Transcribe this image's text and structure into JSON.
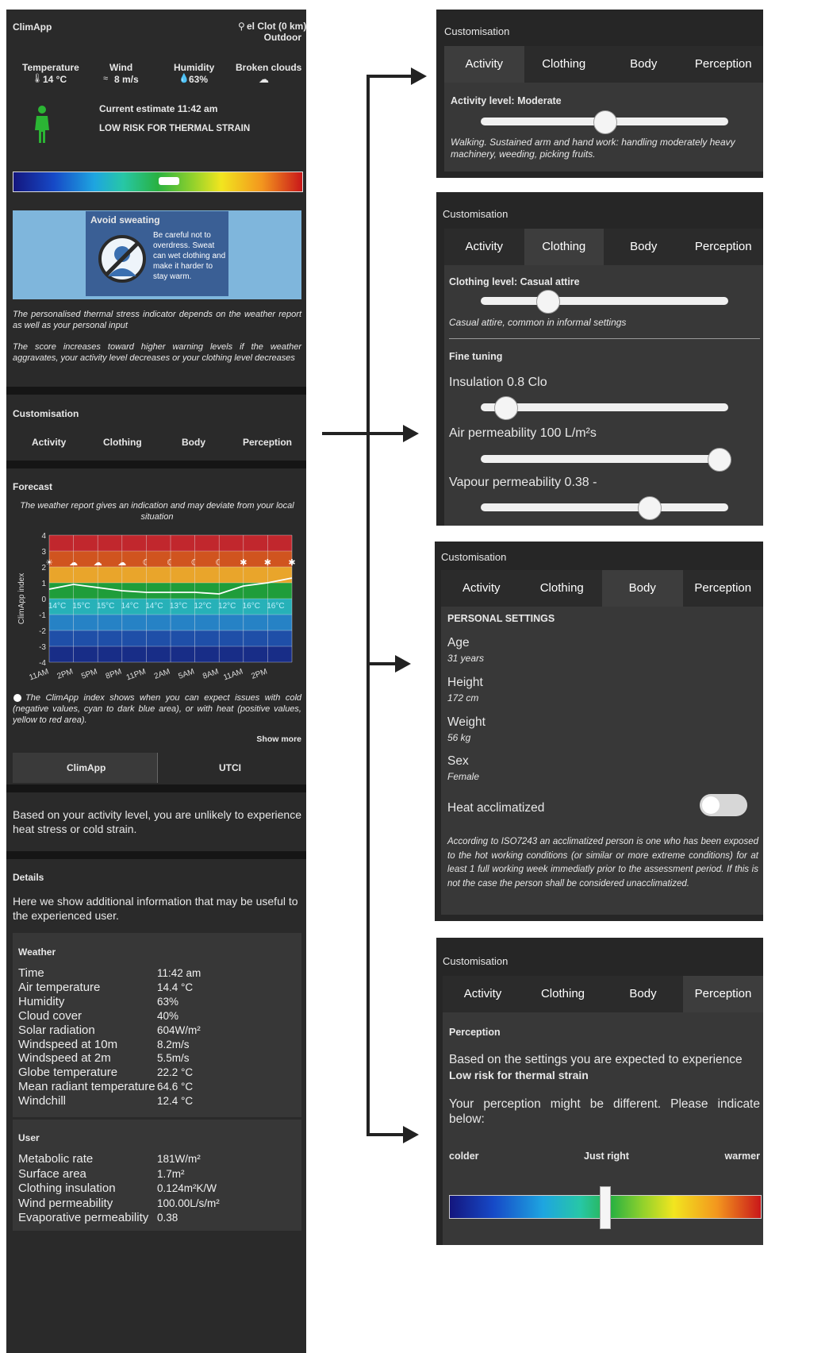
{
  "app": {
    "title": "ClimApp",
    "location": "el Clot (0 km)",
    "mode": "Outdoor"
  },
  "conditions": [
    {
      "label": "Temperature",
      "value": "14 °C",
      "icon": "thermometer-icon"
    },
    {
      "label": "Wind",
      "value": "8 m/s",
      "icon": "wind-icon"
    },
    {
      "label": "Humidity",
      "value": "63%",
      "icon": "drop-icon"
    },
    {
      "label": "Broken clouds",
      "value": "",
      "icon": "cloud-icon"
    }
  ],
  "estimate": {
    "time_text": "Current estimate 11:42 am",
    "risk_text": "LOW RISK FOR THERMAL STRAIN",
    "gauge_level": 0.54
  },
  "advice": {
    "title": "Avoid sweating",
    "body": "Be careful not to overdress. Sweat can wet clothing and make it harder to stay warm."
  },
  "info_text_1": "The personalised thermal stress indicator depends on the weather report as well as your personal input",
  "info_text_2": "The score increases toward higher warning levels if the weather aggravates, your activity level decreases or your clothing level decreases",
  "customisation": {
    "title": "Customisation",
    "tabs": [
      "Activity",
      "Clothing",
      "Body",
      "Perception"
    ]
  },
  "forecast": {
    "title": "Forecast",
    "note": "The weather report gives an indication and may deviate from your local situation",
    "legend_text": "The ClimApp index shows when you can expect issues with cold (negative values, cyan to dark blue area), or with heat (positive values, yellow to red area).",
    "show_more": "Show more",
    "toggle": [
      "ClimApp",
      "UTCI"
    ]
  },
  "chart_data": {
    "type": "line",
    "ylabel": "ClimApp index",
    "ylim": [
      -4,
      4
    ],
    "yticks": [
      "4",
      "3",
      "2",
      "1",
      "0",
      "-1",
      "-2",
      "-3",
      "-4"
    ],
    "x": [
      "11AM",
      "2PM",
      "5PM",
      "8PM",
      "11PM",
      "2AM",
      "5AM",
      "8AM",
      "11AM",
      "2PM"
    ],
    "series": [
      {
        "values": [
          0.6,
          0.9,
          0.7,
          0.5,
          0.4,
          0.4,
          0.4,
          0.3,
          0.8,
          1.0,
          1.3
        ]
      }
    ],
    "temp_labels": [
      "14°C",
      "15°C",
      "15°C",
      "14°C",
      "14°C",
      "13°C",
      "12°C",
      "12°C",
      "16°C",
      "16°C"
    ],
    "band_colors": [
      "#c1272d",
      "#d0541f",
      "#e9a52b",
      "#1f9d3a",
      "#27b1b8",
      "#2682c5",
      "#1f4fa8",
      "#182d87"
    ]
  },
  "summary_text": "Based on your activity level, you are unlikely to experience heat stress or cold strain.",
  "details": {
    "title": "Details",
    "intro": "Here we show additional information that may be useful to the experienced user.",
    "weather_title": "Weather",
    "weather": [
      {
        "label": "Time",
        "value": "11:42 am"
      },
      {
        "label": "Air temperature",
        "value": "14.4 °C"
      },
      {
        "label": "Humidity",
        "value": "63%"
      },
      {
        "label": "Cloud cover",
        "value": "40%"
      },
      {
        "label": "Solar radiation",
        "value": "604W/m²"
      },
      {
        "label": "Windspeed at 10m",
        "value": "8.2m/s"
      },
      {
        "label": "Windspeed at 2m",
        "value": "5.5m/s"
      },
      {
        "label": "Globe temperature",
        "value": "22.2 °C"
      },
      {
        "label": "Mean radiant temperature",
        "value": "64.6 °C"
      },
      {
        "label": "Windchill",
        "value": "12.4 °C"
      }
    ],
    "user_title": "User",
    "user": [
      {
        "label": "Metabolic rate",
        "value": "181W/m²"
      },
      {
        "label": "Surface area",
        "value": "1.7m²"
      },
      {
        "label": "Clothing insulation",
        "value": "0.124m²K/W"
      },
      {
        "label": "Wind permeability",
        "value": "100.00L/s/m²"
      },
      {
        "label": "Evaporative permeability",
        "value": "0.38"
      }
    ]
  },
  "activity_panel": {
    "label": "Activity level: Moderate",
    "level": 0.5,
    "description": "Walking. Sustained arm and hand work: handling moderately heavy machinery, weeding, picking fruits."
  },
  "clothing_panel": {
    "label": "Clothing level: Casual attire",
    "level": 0.27,
    "description": "Casual attire, common in informal settings",
    "fine_title": "Fine tuning",
    "insulation": "Insulation 0.8 Clo",
    "insulation_level": 0.1,
    "air": "Air permeability 100 L/m²s",
    "air_level": 0.96,
    "vapour": "Vapour permeability 0.38 -",
    "vapour_level": 0.68
  },
  "body_panel": {
    "section": "PERSONAL SETTINGS",
    "fields": [
      {
        "label": "Age",
        "value": "31 years"
      },
      {
        "label": "Height",
        "value": "172 cm"
      },
      {
        "label": "Weight",
        "value": "56 kg"
      },
      {
        "label": "Sex",
        "value": "Female"
      }
    ],
    "acclimatized_label": "Heat acclimatized",
    "acclimatized": false,
    "note": "According to ISO7243 an acclimatized person is one who has been exposed to the hot working conditions (or similar or more extreme conditions) for at least 1 full working week immediatly prior to the assessment period. If this is not the case the person shall be considered unacclimatized."
  },
  "perception_panel": {
    "title": "Perception",
    "expect_text": "Based on the settings you are expected to experience",
    "expect_value": "Low risk for thermal strain",
    "prompt": "Your perception might be different. Please indicate below:",
    "scale": [
      "colder",
      "Just right",
      "warmer"
    ],
    "level": 0.5
  }
}
